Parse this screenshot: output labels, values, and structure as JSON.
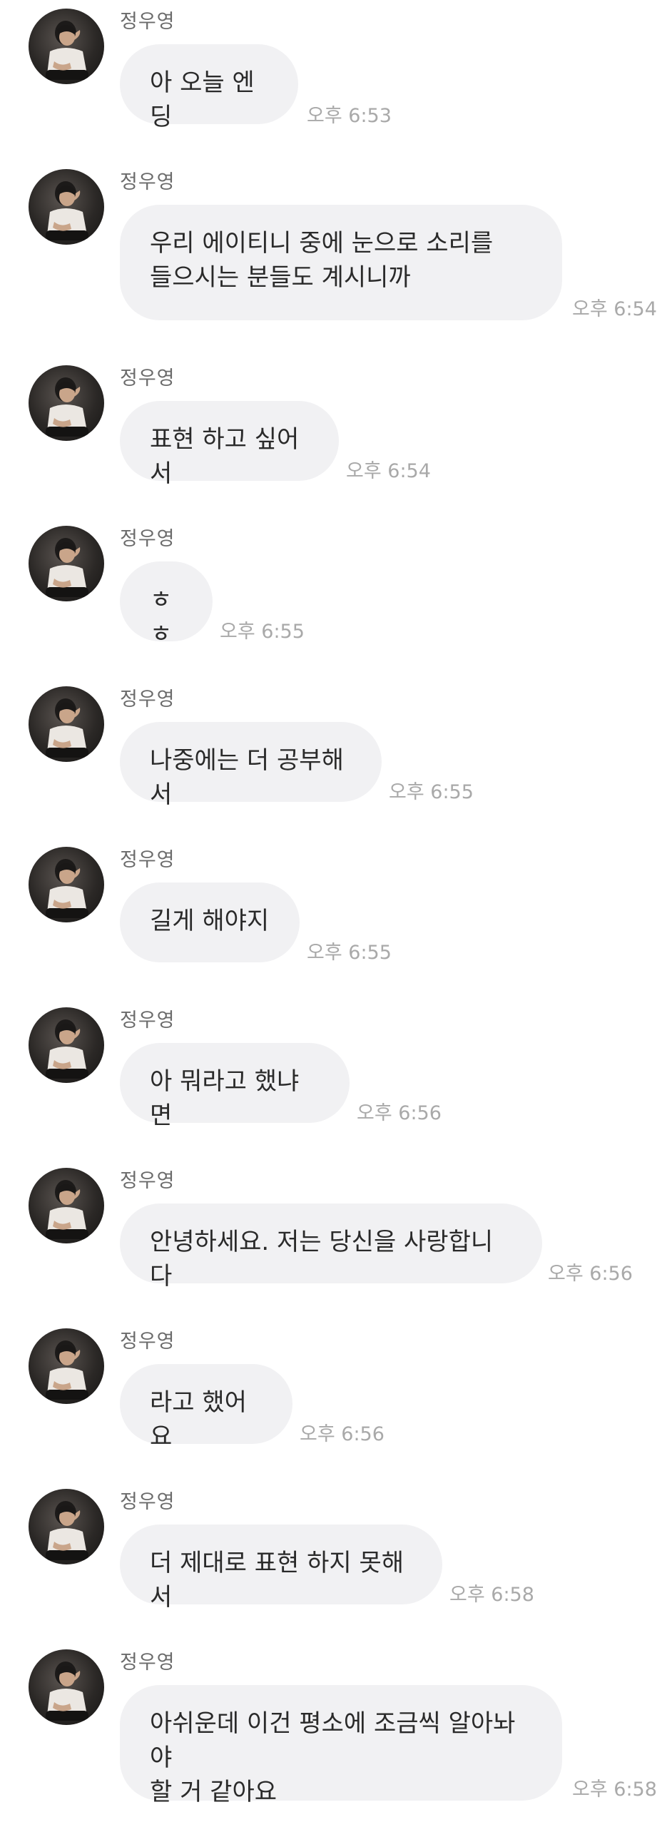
{
  "messages": [
    {
      "sender": "정우영",
      "text": "아 오늘 엔딩",
      "time": "오후 6:53"
    },
    {
      "sender": "정우영",
      "text": "우리 에이티니 중에 눈으로 소리를\n들으시는 분들도 계시니까",
      "time": "오후 6:54"
    },
    {
      "sender": "정우영",
      "text": "표현 하고 싶어서",
      "time": "오후 6:54"
    },
    {
      "sender": "정우영",
      "text": "ㅎㅎ",
      "time": "오후 6:55"
    },
    {
      "sender": "정우영",
      "text": "나중에는 더 공부해서",
      "time": "오후 6:55"
    },
    {
      "sender": "정우영",
      "text": "길게 해야지",
      "time": "오후 6:55"
    },
    {
      "sender": "정우영",
      "text": "아 뭐라고 했냐면",
      "time": "오후 6:56"
    },
    {
      "sender": "정우영",
      "text": "안녕하세요. 저는 당신을 사랑합니다",
      "time": "오후 6:56"
    },
    {
      "sender": "정우영",
      "text": "라고 했어요",
      "time": "오후 6:56"
    },
    {
      "sender": "정우영",
      "text": "더 제대로 표현 하지 못해서",
      "time": "오후 6:58"
    },
    {
      "sender": "정우영",
      "text": "아쉬운데 이건 평소에 조금씩 알아놔야\n할 거 같아요",
      "time": "오후 6:58"
    }
  ]
}
